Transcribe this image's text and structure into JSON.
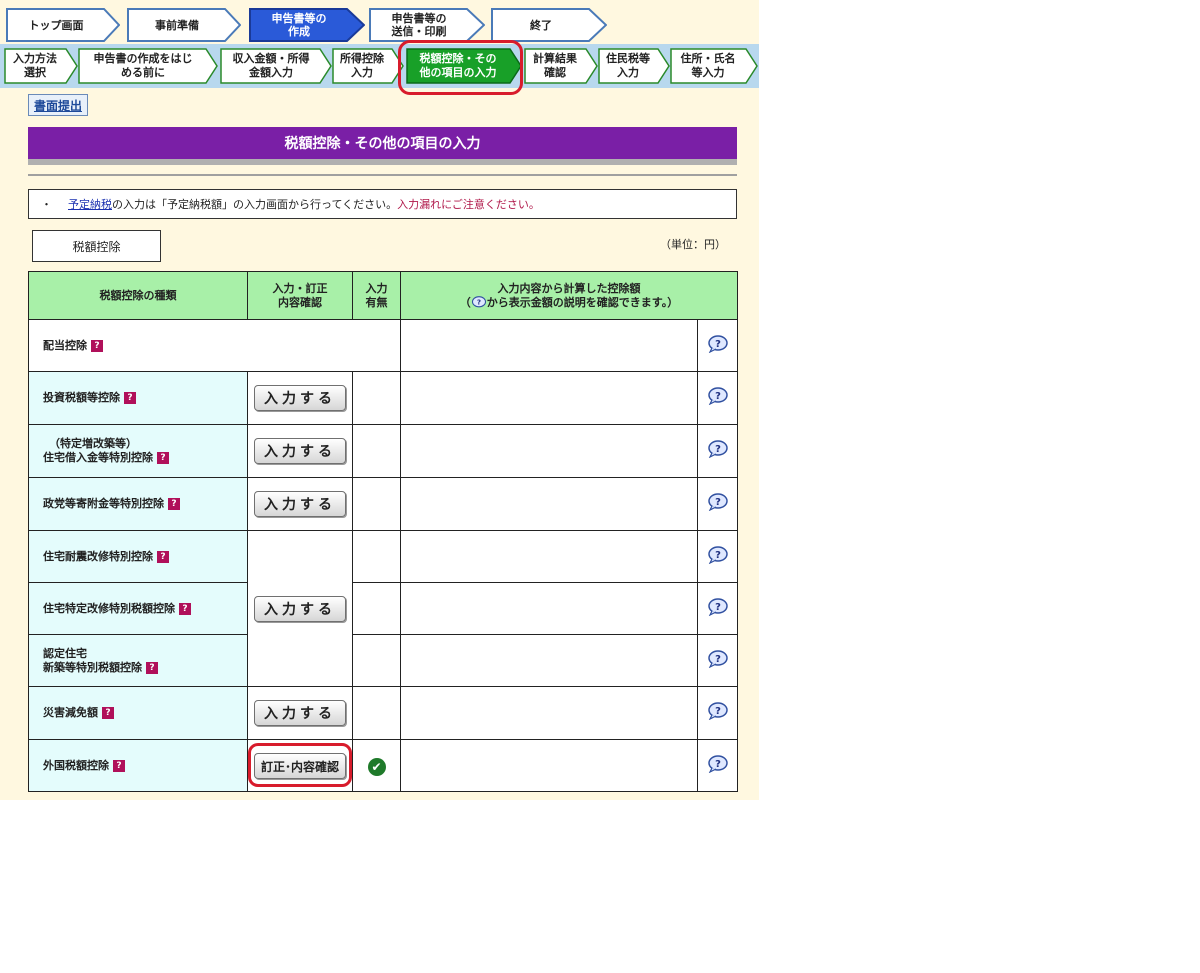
{
  "steps": [
    {
      "label": "トップ画面",
      "active": false
    },
    {
      "label": "事前準備",
      "active": false
    },
    {
      "label": "申告書等の\n作成",
      "active": true
    },
    {
      "label": "申告書等の\n送信・印刷",
      "active": false
    },
    {
      "label": "終了",
      "active": false
    }
  ],
  "substeps": [
    {
      "label": "入力方法\n選択",
      "active": false
    },
    {
      "label": "申告書の作成をはじ\nめる前に",
      "active": false
    },
    {
      "label": "収入金額・所得\n金額入力",
      "active": false
    },
    {
      "label": "所得控除\n入力",
      "active": false
    },
    {
      "label": "税額控除・その\n他の項目の入力",
      "active": true
    },
    {
      "label": "計算結果\n確認",
      "active": false
    },
    {
      "label": "住民税等\n入力",
      "active": false
    },
    {
      "label": "住所・氏名\n等入力",
      "active": false
    }
  ],
  "paper_submit": "書面提出",
  "page_title": "税額控除・その他の項目の入力",
  "notice": {
    "bullet": "・",
    "link": "予定納税",
    "text": "の入力は「予定納税額」の入力画面から行ってください。",
    "warning": "入力漏れにご注意ください。"
  },
  "section_label": "税額控除",
  "unit": "（単位：円）",
  "table": {
    "headers": {
      "kind": "税額控除の種類",
      "input": "入力・訂正\n内容確認",
      "has_input": "入力\n有無",
      "amount_line1": "入力内容から計算した控除額",
      "amount_line2_pre": "（",
      "amount_line2_post": "から表示金額の説明を確認できます。）"
    },
    "input_button": "入力する",
    "edit_button": "訂正･内容確認",
    "rows": [
      {
        "name": "配当控除"
      },
      {
        "name": "投資税額等控除"
      },
      {
        "name_line1": "（特定増改築等）",
        "name": "住宅借入金等特別控除"
      },
      {
        "name": "政党等寄附金等特別控除"
      },
      {
        "name": "住宅耐震改修特別控除"
      },
      {
        "name": "住宅特定改修特別税額控除"
      },
      {
        "name_line1": "認定住宅",
        "name": "新築等特別税額控除"
      },
      {
        "name": "災害減免額"
      },
      {
        "name": "外国税額控除"
      }
    ]
  },
  "colors": {
    "title_bg": "#7a1fa6",
    "header_bg": "#a8f0a8",
    "row_bg": "#e4fcfc",
    "highlight": "#d81c2c",
    "active_step": "#2a5ad8",
    "active_substep": "#18a028"
  }
}
